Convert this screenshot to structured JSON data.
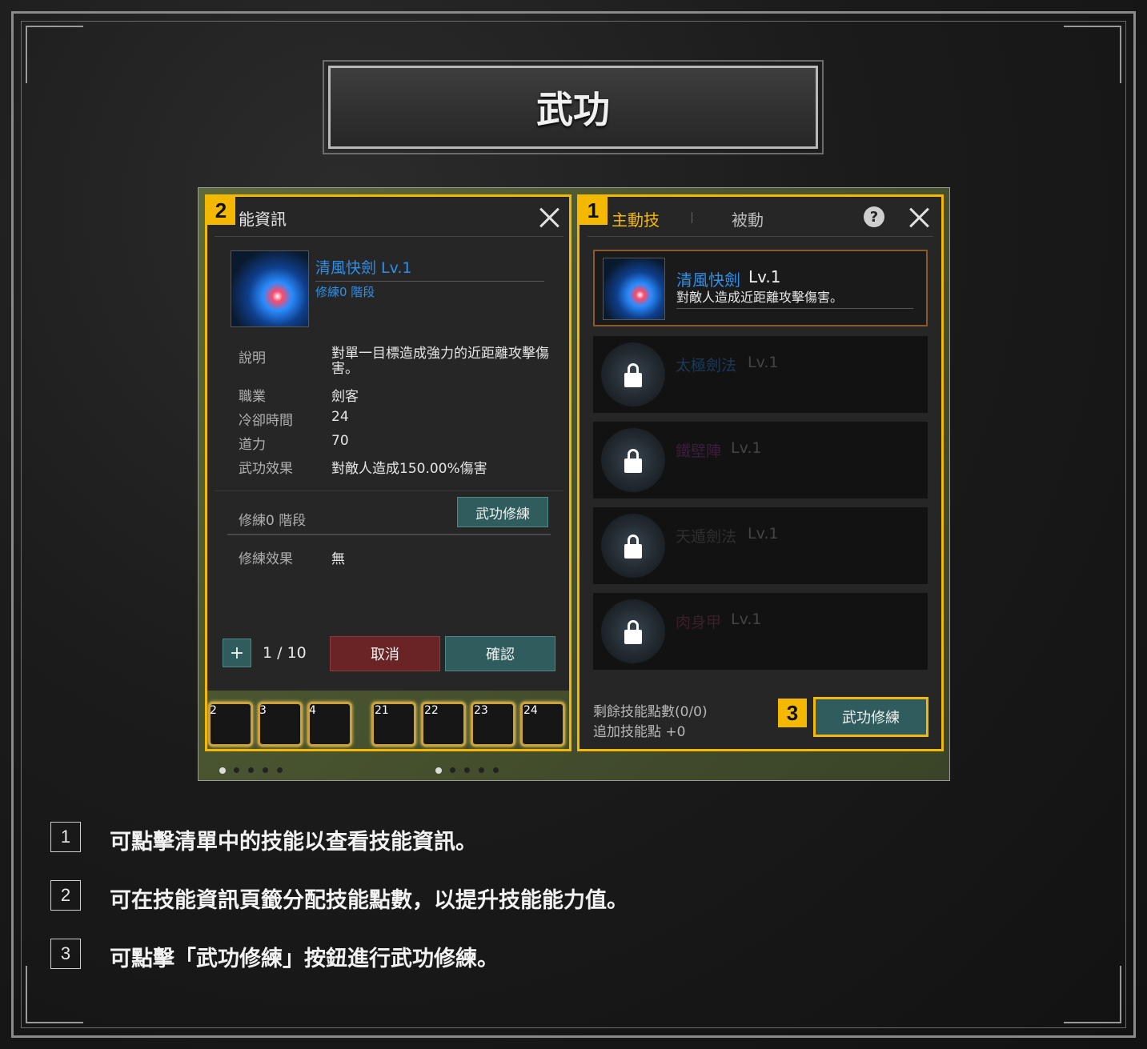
{
  "title": "武功",
  "left_panel": {
    "marker": "2",
    "title": "能資訊",
    "skill_name": "清風快劍 Lv.1",
    "skill_stage": "修練0 階段",
    "rows": [
      {
        "label": "說明",
        "value": "對單一目標造成強力的近距離攻擊傷害。"
      },
      {
        "label": "職業",
        "value": "劍客"
      },
      {
        "label": "冷卻時間",
        "value": "24"
      },
      {
        "label": "道力",
        "value": "70"
      },
      {
        "label": "武功效果",
        "value": "對敵人造成150.00%傷害"
      }
    ],
    "stage_label": "修練0 階段",
    "train_button": "武功修練",
    "effect_label": "修練效果",
    "effect_value": "無",
    "plus_label": "+",
    "counter": "1 / 10",
    "cancel_button": "取消",
    "confirm_button": "確認"
  },
  "hotbar": {
    "slots": [
      "2",
      "3",
      "4",
      "21",
      "22",
      "23",
      "24"
    ]
  },
  "right_panel": {
    "marker": "1",
    "tab_active": "主動技",
    "tab_passive": "被動",
    "help_icon": "?",
    "selected_skill": {
      "name": "清風快劍",
      "level": "Lv.1",
      "desc": "對敵人造成近距離攻擊傷害。"
    },
    "locked_skills": [
      {
        "name": "太極劍法",
        "level": "Lv.1"
      },
      {
        "name": "鐵壁陣",
        "level": "Lv.1"
      },
      {
        "name": "天遁劍法",
        "level": "Lv.1"
      },
      {
        "name": "肉身甲",
        "level": "Lv.1"
      }
    ],
    "points_remaining": "剩餘技能點數(0/0)",
    "points_added": "追加技能點 +0",
    "train_marker": "3",
    "train_button": "武功修練"
  },
  "legend": [
    {
      "num": "1",
      "text": "可點擊清單中的技能以查看技能資訊。"
    },
    {
      "num": "2",
      "text": "可在技能資訊頁籤分配技能點數，以提升技能能力值。"
    },
    {
      "num": "3",
      "text": "可點擊「武功修練」按鈕進行武功修練。"
    }
  ],
  "colors": {
    "highlight": "#f5b800",
    "skill_blue": "#2e8fe8",
    "teal_button": "#2f5d5e",
    "red_button": "#6b2426"
  }
}
